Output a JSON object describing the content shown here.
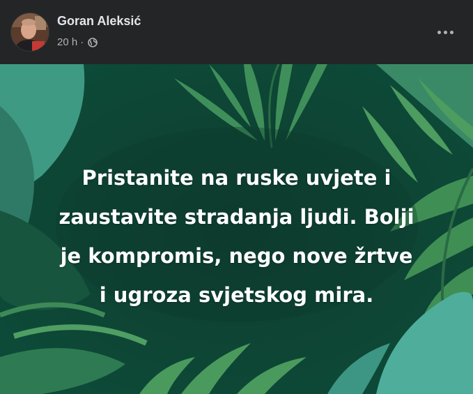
{
  "author": {
    "name": "Goran Aleksić",
    "avatar_icon": "profile-photo"
  },
  "meta": {
    "time": "20 h",
    "separator": "·",
    "audience_icon": "globe-icon"
  },
  "actions": {
    "more_icon": "more-horizontal-icon"
  },
  "post": {
    "lines": [
      "Pristanite na ruske uvjete i",
      "zaustavite stradanja ljudi. Bolji",
      "je kompromis, nego nove žrtve",
      "i ugroza svjetskog mira."
    ],
    "background_colors": {
      "base": "#0e4a3a",
      "dark_leaf": "#124d3c",
      "mid_leaf": "#2f7a55",
      "light_leaf": "#5aa870",
      "teal_leaf": "#4fae9b"
    }
  }
}
